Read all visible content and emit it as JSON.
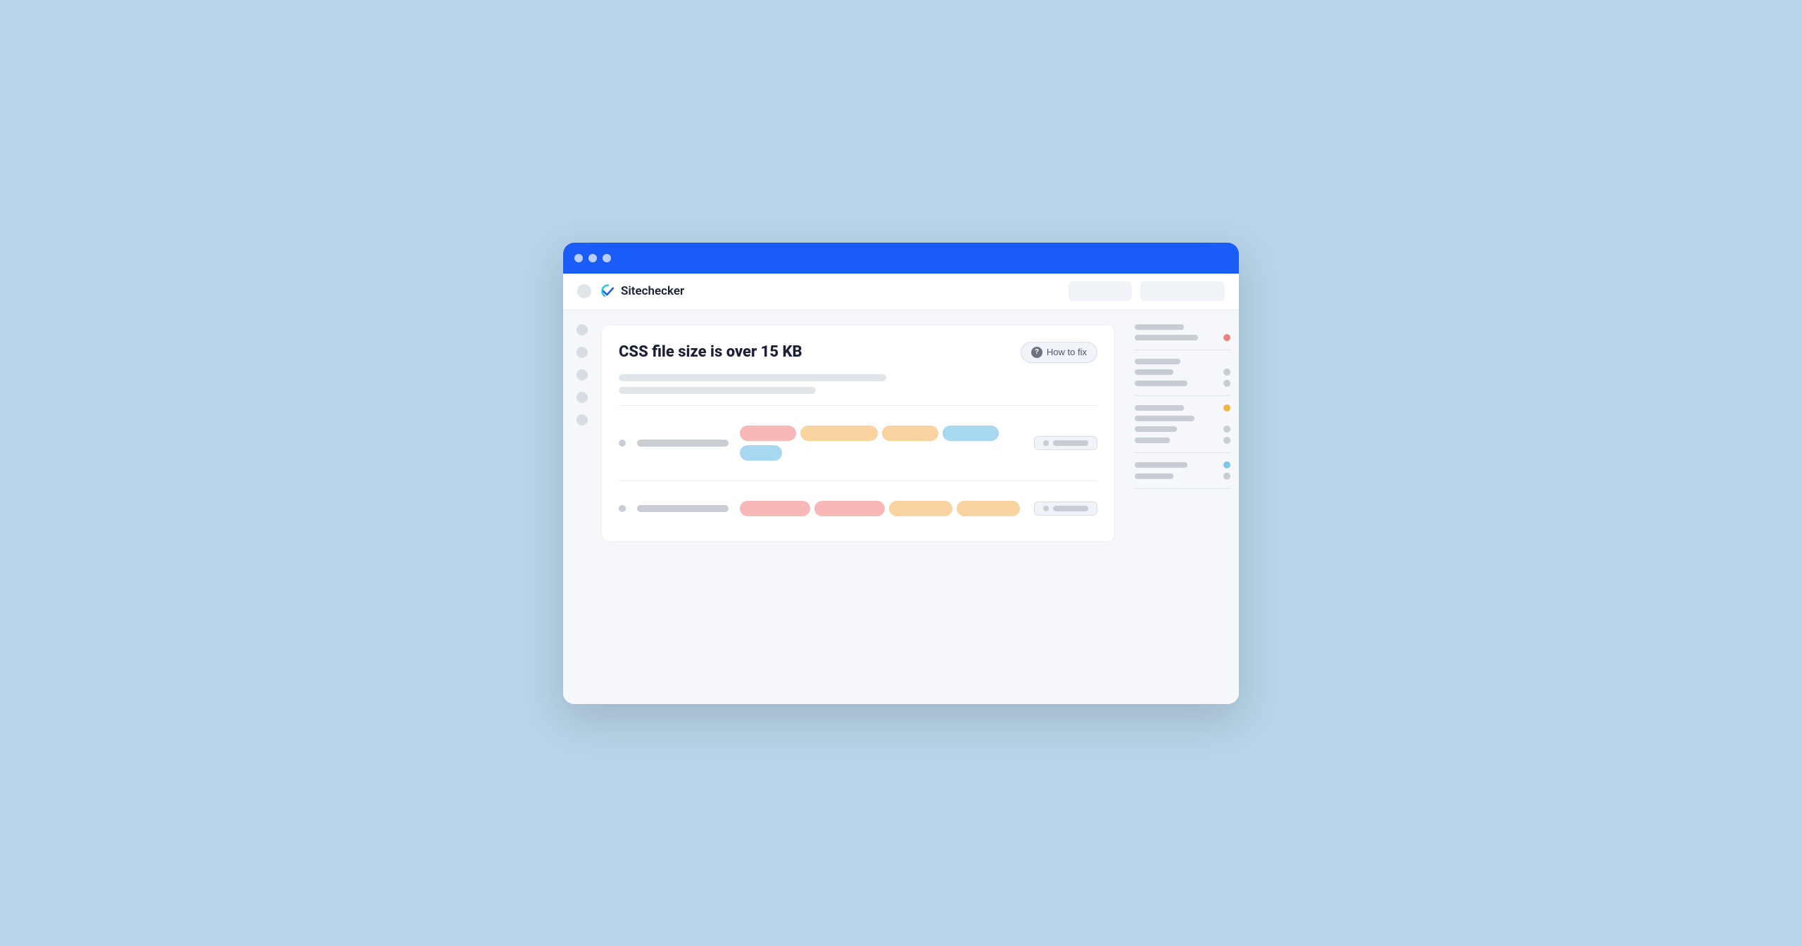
{
  "browser": {
    "dots": [
      "dot1",
      "dot2",
      "dot3"
    ],
    "brand_name": "Sitechecker",
    "toolbar_btn1": "",
    "toolbar_btn2": ""
  },
  "card": {
    "title": "CSS file size is over 15 KB",
    "how_to_fix": "How to fix"
  },
  "rows": [
    {
      "tags": [
        {
          "color": "pink",
          "size": "md"
        },
        {
          "color": "peach",
          "size": "lg"
        },
        {
          "color": "peach",
          "size": "sm"
        },
        {
          "color": "peach",
          "size": "sm"
        },
        {
          "color": "blue",
          "size": "sm"
        },
        {
          "color": "blue-light",
          "size": "sm"
        }
      ]
    },
    {
      "tags": [
        {
          "color": "pink",
          "size": "lg"
        },
        {
          "color": "pink",
          "size": "lg"
        },
        {
          "color": "peach",
          "size": "xl"
        },
        {
          "color": "peach",
          "size": "xl"
        }
      ]
    }
  ],
  "right_panel": {
    "sections": [
      {
        "lines": [
          60,
          80
        ],
        "indicator": "none"
      },
      {
        "lines": [
          70,
          50
        ],
        "indicator": "red"
      },
      {
        "lines": [
          55,
          65,
          45
        ],
        "indicator": "none"
      },
      {
        "lines": [
          60,
          70
        ],
        "indicator": "orange"
      },
      {
        "lines": [
          50,
          60,
          55,
          45
        ],
        "indicator": "none"
      },
      {
        "lines": [
          65,
          45
        ],
        "indicator": "blue"
      }
    ]
  }
}
